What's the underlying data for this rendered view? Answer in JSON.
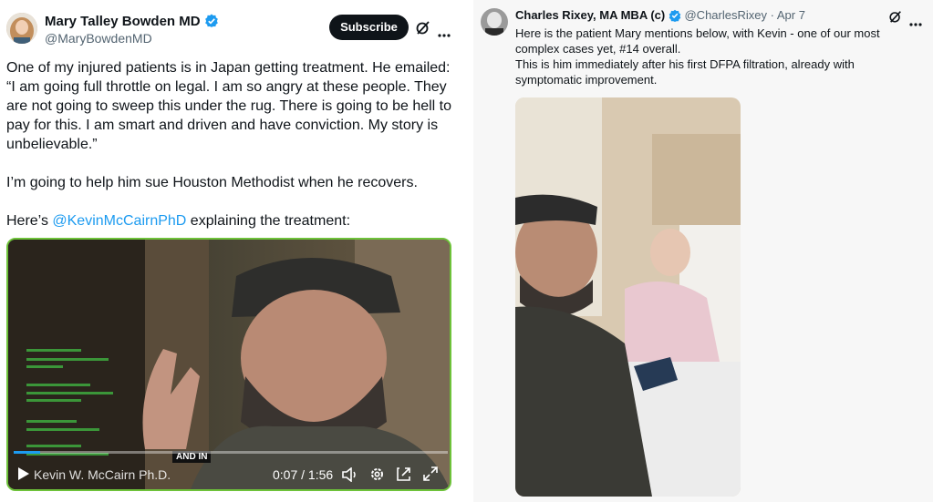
{
  "left_tweet": {
    "author_name": "Mary Talley Bowden MD",
    "author_handle": "@MaryBowdenMD",
    "subscribe_label": "Subscribe",
    "paragraph1": "One of my injured patients is in Japan getting treatment. He emailed: “I am going full throttle on legal. I am so angry at these people. They are not going to sweep this under the rug. There is going to be hell to pay for this.  I am smart and driven and have conviction. My story is unbelievable.”",
    "paragraph2": "I’m going to help him sue Houston Methodist when he recovers.",
    "paragraph3_prefix": "Here’s ",
    "paragraph3_mention": "@KevinMcCairnPhD",
    "paragraph3_suffix": " explaining the treatment:",
    "video": {
      "caption": "AND IN",
      "name_overlay": "Kevin W. McCairn Ph.D.",
      "time": "0:07 / 1:56",
      "progress": 0.06
    }
  },
  "right_tweet": {
    "author_name": "Charles Rixey, MA MBA (c)",
    "author_handle": "@CharlesRixey",
    "separator": "·",
    "date": "Apr 7",
    "line1": "Here is the patient Mary mentions below, with Kevin - one of our most complex cases yet, #14 overall.",
    "line2": "This is him immediately after his first DFPA filtration, already with symptomatic improvement."
  },
  "colors": {
    "verified": "#1d9bf0",
    "link": "#1d9bf0",
    "video_border": "#6ec23a"
  },
  "icons": [
    "verified-badge-icon",
    "grok-icon",
    "more-icon",
    "play-icon",
    "volume-icon",
    "settings-icon",
    "exit-icon",
    "fullscreen-icon"
  ]
}
